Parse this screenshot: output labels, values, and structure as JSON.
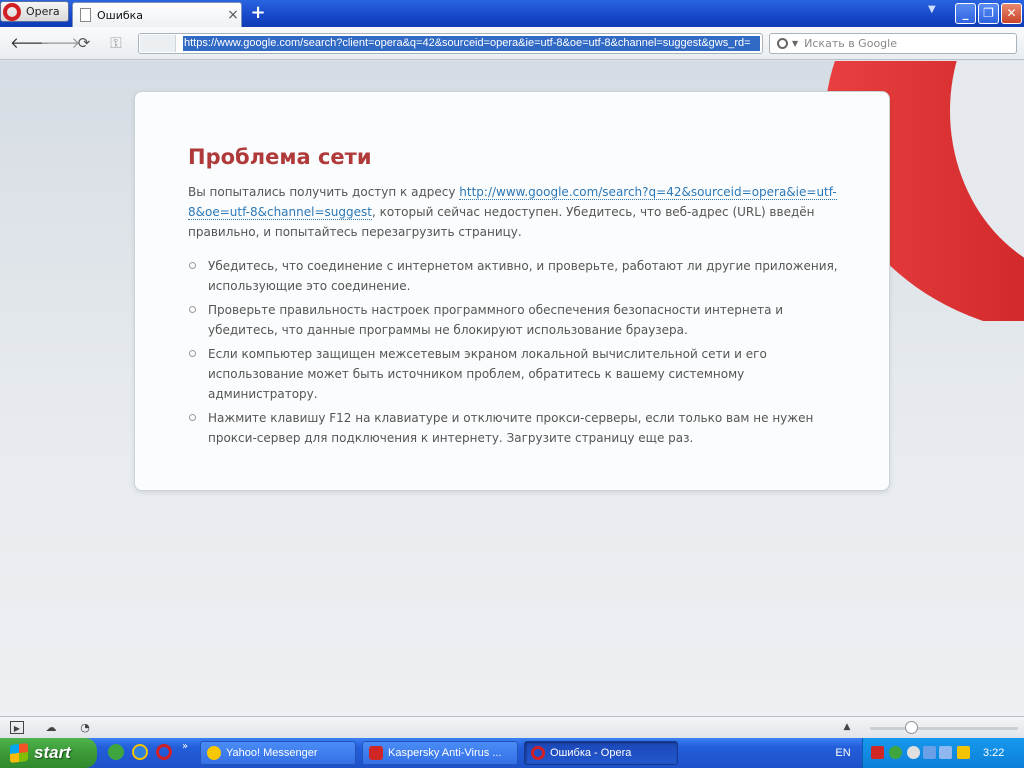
{
  "browser": {
    "menu_label": "Opera",
    "tab_title": "Ошибка",
    "new_tab_glyph": "+",
    "address_url": "https://www.google.com/search?client=opera&q=42&sourceid=opera&ie=utf-8&oe=utf-8&channel=suggest&gws_rd=",
    "search_placeholder": "Искать в Google",
    "accent_color": "#d21f24"
  },
  "error_page": {
    "title": "Проблема сети",
    "desc_before": "Вы попытались получить доступ к адресу ",
    "link_text": "http://www.google.com/search?q=42&sourceid=opera&ie=utf-8&oe=utf-8&channel=suggest",
    "desc_after": ", который сейчас недоступен. Убедитесь, что веб-адрес (URL) введён правильно, и попытайтесь перезагрузить страницу.",
    "tips": [
      "Убедитесь, что соединение с интернетом активно, и проверьте, работают ли другие приложения, использующие это соединение.",
      "Проверьте правильность настроек программного обеспечения безопасности интернета и убедитесь, что данные программы не блокируют использование браузера.",
      "Если компьютер защищен межсетевым экраном локальной вычислительной сети и его использование может быть источником проблем, обратитесь к вашему системному администратору.",
      "Нажмите клавишу F12 на клавиатуре и отключите прокси-серверы, если только вам не нужен прокси-сервер для подключения к интернету. Загрузите страницу еще раз."
    ],
    "title_color": "#b03a3a",
    "link_color": "#2b78b8"
  },
  "taskbar": {
    "start_label": "start",
    "tasks": [
      {
        "label": "Yahoo! Messenger"
      },
      {
        "label": "Kaspersky Anti-Virus ..."
      },
      {
        "label": "Ошибка - Opera"
      }
    ],
    "language": "EN",
    "clock": "3:22"
  },
  "icons": {
    "back": "back-arrow-icon",
    "forward": "forward-arrow-icon",
    "reload": "reload-icon",
    "wand": "wand-key-icon",
    "search": "magnifier-icon"
  }
}
